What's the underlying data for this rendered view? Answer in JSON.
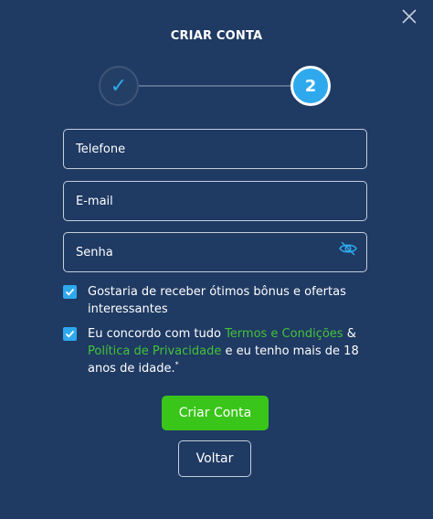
{
  "modal": {
    "title": "CRIAR CONTA"
  },
  "stepper": {
    "steps": [
      {
        "label": "✓",
        "state": "completed"
      },
      {
        "label": "2",
        "state": "active"
      }
    ]
  },
  "form": {
    "phone": {
      "placeholder": "Telefone",
      "value": ""
    },
    "email": {
      "placeholder": "E-mail",
      "value": ""
    },
    "password": {
      "placeholder": "Senha",
      "value": "",
      "icon": "eye-slash-icon"
    },
    "bonus_opt_in": {
      "checked": true,
      "text": "Gostaria de receber ótimos bônus e ofertas interessantes"
    },
    "terms": {
      "checked": true,
      "text_1": "Eu concordo com tudo ",
      "link_terms": "Termos e Condições",
      "text_2": " & ",
      "link_privacy": "Política de Privacidade",
      "text_3": " e eu tenho mais de 18 anos de idade.",
      "asterisk": "*"
    }
  },
  "buttons": {
    "create_account": "Criar Conta",
    "back": "Voltar"
  },
  "colors": {
    "background": "#1f3a63",
    "accent_blue": "#2ea9ee",
    "accent_green": "#3ac51a",
    "link_green": "#44c23a"
  }
}
